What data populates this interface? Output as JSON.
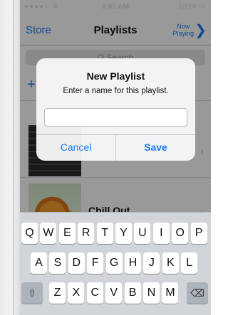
{
  "status_bar": {
    "signal": "●●●●○ ≋",
    "time": "9:41 AM",
    "battery": "100% ▭"
  },
  "nav": {
    "back_label": "Store",
    "title": "Playlists",
    "now_playing_line1": "Now",
    "now_playing_line2": "Playing",
    "chevron": "❯"
  },
  "search": {
    "placeholder": "Q Search"
  },
  "list": {
    "add_symbol": "+",
    "rows": [
      {
        "label": ""
      },
      {
        "label": "Chill Out"
      }
    ],
    "row_chevron": "›"
  },
  "alert": {
    "title": "New Playlist",
    "message": "Enter a name for this playlist.",
    "input_value": "",
    "input_placeholder": "",
    "cancel_label": "Cancel",
    "save_label": "Save"
  },
  "keyboard": {
    "row1": [
      "Q",
      "W",
      "E",
      "R",
      "T",
      "Y",
      "U",
      "I",
      "O",
      "P"
    ],
    "row2": [
      "A",
      "S",
      "D",
      "F",
      "G",
      "H",
      "J",
      "K",
      "L"
    ],
    "row3": [
      "Z",
      "X",
      "C",
      "V",
      "B",
      "N",
      "M"
    ],
    "shift_glyph": "⇧",
    "delete_glyph": "⌫"
  },
  "colors": {
    "accent": "#1b7bf5",
    "keyboard_bg": "#d1d4d9"
  }
}
